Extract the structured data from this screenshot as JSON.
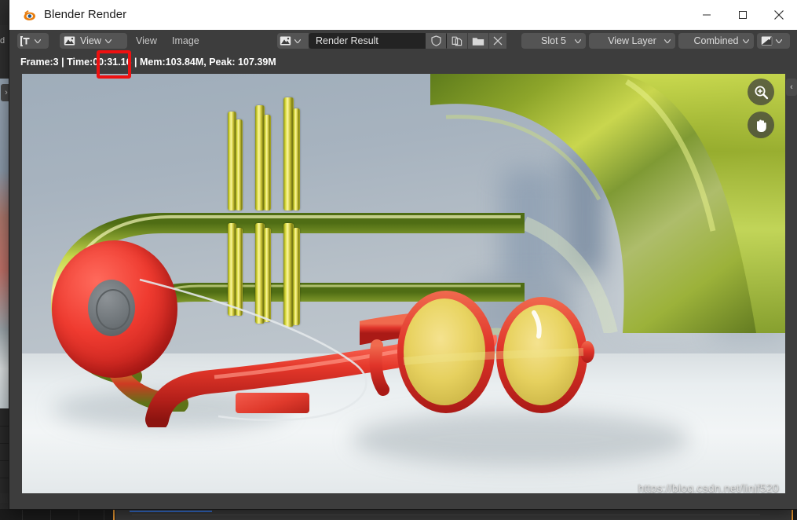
{
  "window": {
    "title": "Blender Render",
    "logo_icon": "blender-logo-icon",
    "controls": {
      "minimize": "minimize-icon",
      "maximize": "maximize-icon",
      "close": "close-icon"
    }
  },
  "header": {
    "editor_type_icon": "image-editor-type-icon",
    "editor_type_chevron": "chevron-down-icon",
    "display_mode_icon": "image-view-mode-icon",
    "display_mode_label": "View",
    "display_mode_chevron": "chevron-down-icon",
    "menus": [
      "View",
      "Image"
    ],
    "datablock_icon": "image-datablock-icon",
    "datablock_chevron": "chevron-down-icon",
    "image_name": "Render Result",
    "fake_user_icon": "shield-icon",
    "duplicate_icon": "copy-icon",
    "open_icon": "folder-icon",
    "unlink_icon": "x-icon",
    "slot": {
      "label": "Slot 5",
      "chevron": "chevron-down-icon"
    },
    "view_layer": {
      "label": "View Layer",
      "chevron": "chevron-down-icon"
    },
    "pass": {
      "label": "Combined",
      "chevron": "chevron-down-icon"
    },
    "display_channels_icon": "image-alpha-icon",
    "display_channels_chevron": "chevron-down-icon"
  },
  "status": {
    "text": "Frame:3 | Time:00:31.16 | Mem:103.84M, Peak: 107.39M",
    "frame": "3",
    "time": "00:31.16",
    "memory": "103.84M",
    "peak": "107.39M",
    "annotation_color": "#ee1111"
  },
  "viewport": {
    "zoom_tool_icon": "zoom-in-icon",
    "pan_tool_icon": "hand-pan-icon",
    "sidebar_toggle_icon": "chevron-left-icon",
    "render_description": "3D render of a green-gold trumpet with red headphones and red-framed yellow sunglasses on a glossy white surface"
  },
  "background_window": {
    "left_tab_label": "d",
    "expand_toggle_icon": "chevron-right-icon"
  },
  "watermark": "https://blog.csdn.net/linjf520",
  "colors": {
    "accent_orange": "#ed9b35",
    "accent_blue": "#3874d8",
    "header_bg": "#3d3d3d",
    "button_bg": "#545454",
    "field_bg": "#232323",
    "titlebar_bg": "#ffffff",
    "annotation_red": "#ee1111"
  }
}
